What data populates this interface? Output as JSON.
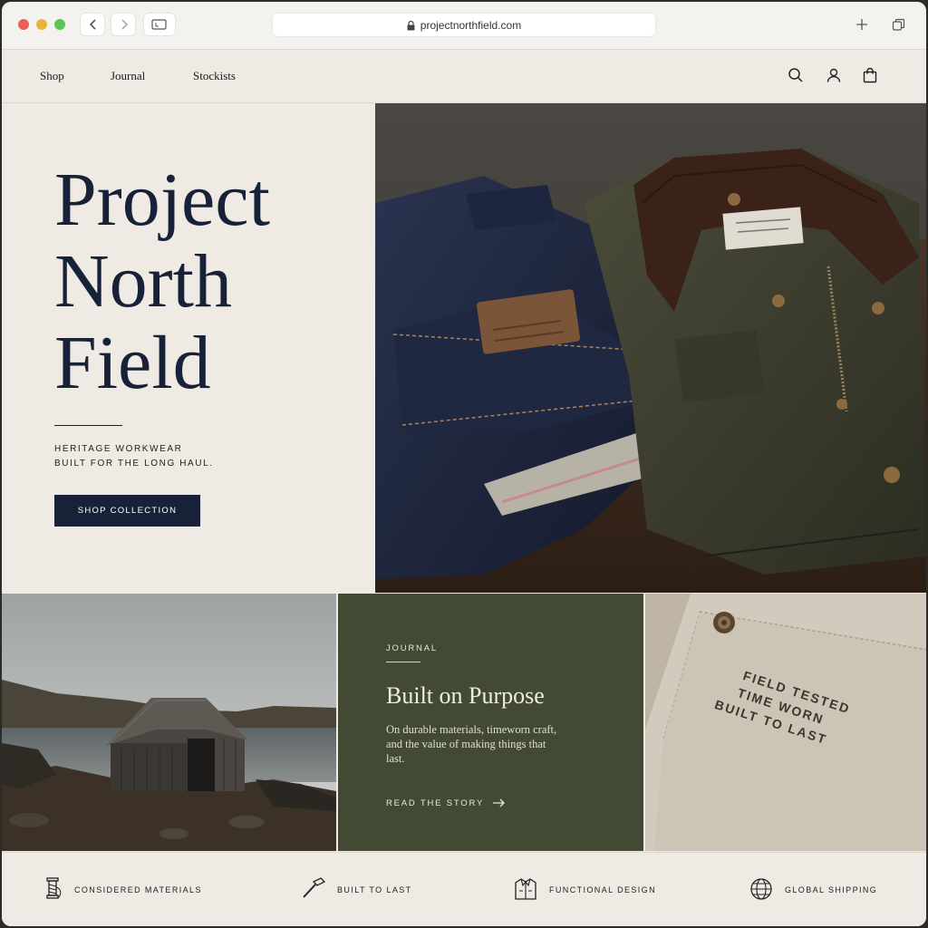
{
  "browser": {
    "url": "projectnorthfield.com"
  },
  "nav": {
    "links": [
      "Shop",
      "Journal",
      "Stockists"
    ],
    "icons": [
      "search-icon",
      "account-icon",
      "bag-icon"
    ]
  },
  "hero": {
    "title_lines": [
      "Project",
      "North",
      "Field"
    ],
    "tagline_lines": [
      "HERITAGE WORKWEAR",
      "BUILT FOR THE LONG HAUL."
    ],
    "cta": "SHOP COLLECTION"
  },
  "journal": {
    "label": "JOURNAL",
    "title": "Built on Purpose",
    "body": "On durable materials, timeworn craft, and the value of making things that last.",
    "link": "READ THE STORY"
  },
  "canvas_tile": {
    "stamp_lines": [
      "FIELD TESTED",
      "TIME WORN",
      "BUILT TO LAST"
    ]
  },
  "features": [
    {
      "icon": "thread-spool-icon",
      "label": "CONSIDERED MATERIALS"
    },
    {
      "icon": "hammer-icon",
      "label": "BUILT TO LAST"
    },
    {
      "icon": "jacket-icon",
      "label": "FUNCTIONAL DESIGN"
    },
    {
      "icon": "globe-icon",
      "label": "GLOBAL SHIPPING"
    }
  ],
  "colors": {
    "navy": "#172238",
    "olive": "#434a33",
    "cream": "#efebe4"
  }
}
